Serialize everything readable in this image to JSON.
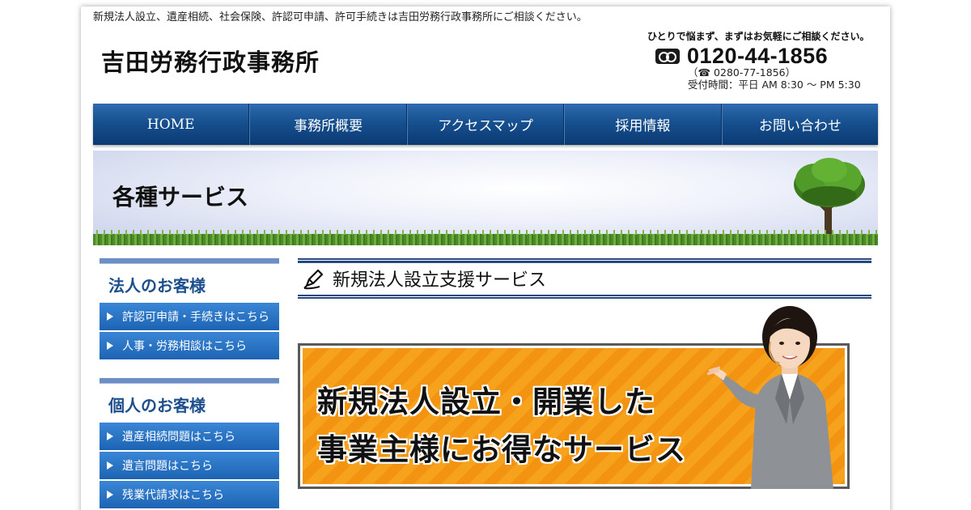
{
  "header": {
    "tagline": "新規法人設立、遺産相続、社会保険、許認可申請、許可手続きは吉田労務行政事務所にご相談ください。",
    "logo": "吉田労務行政事務所",
    "contact": {
      "lead": "ひとりで悩まず、まずはお気軽にご相談ください。",
      "tel": "0120-44-1856",
      "sub_tel": "（☎ 0280-77-1856）",
      "hours": "受付時間：平日 AM 8:30 〜 PM 5:30"
    }
  },
  "nav": {
    "items": [
      {
        "label": "HOME"
      },
      {
        "label": "事務所概要"
      },
      {
        "label": "アクセスマップ"
      },
      {
        "label": "採用情報"
      },
      {
        "label": "お問い合わせ"
      }
    ]
  },
  "hero": {
    "title": "各種サービス"
  },
  "sidebar": {
    "corporate": {
      "title": "法人のお客様",
      "links": [
        {
          "label": "許認可申請・手続きはこちら"
        },
        {
          "label": "人事・労務相談はこちら"
        }
      ]
    },
    "individual": {
      "title": "個人のお客様",
      "links": [
        {
          "label": "遺産相続問題はこちら"
        },
        {
          "label": "遺言問題はこちら"
        },
        {
          "label": "残業代請求はこちら"
        }
      ]
    }
  },
  "main": {
    "section_title": "新規法人設立支援サービス",
    "banner": {
      "line1": "新規法人設立・開業した",
      "line2": "事業主様にお得なサービス"
    }
  },
  "colors": {
    "nav_blue": "#16508f",
    "sidebar_title": "#1e4f8d",
    "banner_orange": "#f7a21c"
  }
}
